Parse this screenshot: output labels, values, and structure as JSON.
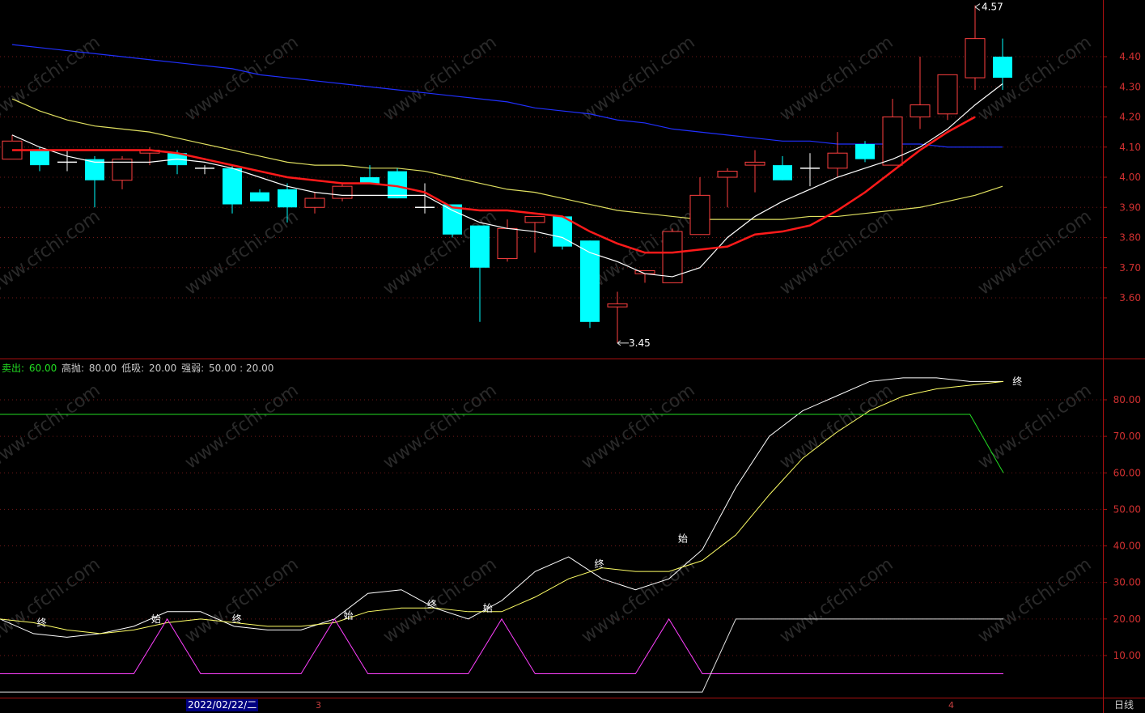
{
  "chart_data": [
    {
      "type": "candlestick",
      "y_ticks": [
        "4.40",
        "4.30",
        "4.20",
        "4.10",
        "4.00",
        "3.90",
        "3.80",
        "3.70",
        "3.60"
      ],
      "ylim": [
        3.42,
        4.58
      ],
      "candles": [
        {
          "o": 4.06,
          "h": 4.14,
          "l": 4.06,
          "c": 4.12
        },
        {
          "o": 4.09,
          "h": 4.1,
          "l": 4.02,
          "c": 4.04
        },
        {
          "o": 4.05,
          "h": 4.09,
          "l": 4.02,
          "c": 4.05
        },
        {
          "o": 4.06,
          "h": 4.07,
          "l": 3.9,
          "c": 3.99
        },
        {
          "o": 3.99,
          "h": 4.07,
          "l": 3.96,
          "c": 4.06
        },
        {
          "o": 4.08,
          "h": 4.1,
          "l": 4.04,
          "c": 4.09
        },
        {
          "o": 4.08,
          "h": 4.09,
          "l": 4.01,
          "c": 4.04
        },
        {
          "o": 4.03,
          "h": 4.04,
          "l": 4.01,
          "c": 4.03
        },
        {
          "o": 4.03,
          "h": 4.04,
          "l": 3.88,
          "c": 3.91
        },
        {
          "o": 3.95,
          "h": 3.96,
          "l": 3.92,
          "c": 3.92
        },
        {
          "o": 3.96,
          "h": 3.98,
          "l": 3.85,
          "c": 3.9
        },
        {
          "o": 3.9,
          "h": 3.95,
          "l": 3.88,
          "c": 3.93
        },
        {
          "o": 3.93,
          "h": 3.98,
          "l": 3.92,
          "c": 3.97
        },
        {
          "o": 4.0,
          "h": 4.04,
          "l": 3.98,
          "c": 3.98
        },
        {
          "o": 4.02,
          "h": 4.03,
          "l": 3.93,
          "c": 3.93
        },
        {
          "o": 3.9,
          "h": 3.98,
          "l": 3.88,
          "c": 3.9
        },
        {
          "o": 3.91,
          "h": 3.91,
          "l": 3.8,
          "c": 3.81
        },
        {
          "o": 3.84,
          "h": 3.84,
          "l": 3.52,
          "c": 3.7
        },
        {
          "o": 3.73,
          "h": 3.86,
          "l": 3.72,
          "c": 3.83
        },
        {
          "o": 3.85,
          "h": 3.87,
          "l": 3.75,
          "c": 3.87
        },
        {
          "o": 3.87,
          "h": 3.87,
          "l": 3.76,
          "c": 3.77
        },
        {
          "o": 3.79,
          "h": 3.79,
          "l": 3.5,
          "c": 3.52
        },
        {
          "o": 3.57,
          "h": 3.62,
          "l": 3.45,
          "c": 3.58
        },
        {
          "o": 3.68,
          "h": 3.69,
          "l": 3.65,
          "c": 3.69
        },
        {
          "o": 3.65,
          "h": 3.83,
          "l": 3.65,
          "c": 3.82
        },
        {
          "o": 3.81,
          "h": 4.0,
          "l": 3.81,
          "c": 3.94
        },
        {
          "o": 4.0,
          "h": 4.03,
          "l": 3.9,
          "c": 4.02
        },
        {
          "o": 4.04,
          "h": 4.09,
          "l": 3.95,
          "c": 4.05
        },
        {
          "o": 4.04,
          "h": 4.07,
          "l": 3.99,
          "c": 3.99
        },
        {
          "o": 4.03,
          "h": 4.08,
          "l": 3.97,
          "c": 4.03
        },
        {
          "o": 4.03,
          "h": 4.15,
          "l": 4.0,
          "c": 4.08
        },
        {
          "o": 4.11,
          "h": 4.12,
          "l": 4.05,
          "c": 4.06
        },
        {
          "o": 4.04,
          "h": 4.26,
          "l": 4.04,
          "c": 4.2
        },
        {
          "o": 4.2,
          "h": 4.4,
          "l": 4.16,
          "c": 4.24
        },
        {
          "o": 4.21,
          "h": 4.34,
          "l": 4.19,
          "c": 4.34
        },
        {
          "o": 4.33,
          "h": 4.57,
          "l": 4.29,
          "c": 4.46
        },
        {
          "o": 4.4,
          "h": 4.46,
          "l": 4.29,
          "c": 4.33
        }
      ],
      "ma_white": [
        4.14,
        4.1,
        4.07,
        4.05,
        4.05,
        4.05,
        4.06,
        4.05,
        4.03,
        4.0,
        3.97,
        3.95,
        3.94,
        3.94,
        3.94,
        3.94,
        3.89,
        3.85,
        3.83,
        3.82,
        3.8,
        3.75,
        3.72,
        3.68,
        3.67,
        3.7,
        3.8,
        3.87,
        3.92,
        3.96,
        4.0,
        4.03,
        4.06,
        4.1,
        4.16,
        4.24,
        4.31
      ],
      "ma_red": [
        4.09,
        4.09,
        4.09,
        4.09,
        4.09,
        4.09,
        4.08,
        4.06,
        4.04,
        4.02,
        4.0,
        3.99,
        3.98,
        3.98,
        3.97,
        3.95,
        3.9,
        3.89,
        3.89,
        3.88,
        3.87,
        3.82,
        3.78,
        3.75,
        3.75,
        3.76,
        3.77,
        3.81,
        3.82,
        3.84,
        3.89,
        3.95,
        4.02,
        4.09,
        4.15,
        4.2
      ],
      "ma_yellow": [
        4.26,
        4.22,
        4.19,
        4.17,
        4.16,
        4.15,
        4.13,
        4.11,
        4.09,
        4.07,
        4.05,
        4.04,
        4.04,
        4.03,
        4.03,
        4.02,
        4.0,
        3.98,
        3.96,
        3.95,
        3.93,
        3.91,
        3.89,
        3.88,
        3.87,
        3.86,
        3.86,
        3.86,
        3.86,
        3.87,
        3.87,
        3.88,
        3.89,
        3.9,
        3.92,
        3.94,
        3.97
      ],
      "ma_blue": [
        4.44,
        4.43,
        4.42,
        4.41,
        4.4,
        4.39,
        4.38,
        4.37,
        4.36,
        4.34,
        4.33,
        4.32,
        4.31,
        4.3,
        4.29,
        4.28,
        4.27,
        4.26,
        4.25,
        4.23,
        4.22,
        4.21,
        4.19,
        4.18,
        4.16,
        4.15,
        4.14,
        4.13,
        4.12,
        4.12,
        4.11,
        4.11,
        4.11,
        4.11,
        4.1,
        4.1,
        4.1
      ],
      "high_label": "4.57",
      "low_label": "3.45",
      "high_index": 35,
      "low_index": 22
    },
    {
      "type": "line",
      "title_items": [
        {
          "label": "卖出: ",
          "value": "60.00",
          "color": "#22dd22"
        },
        {
          "label": "高抛: ",
          "value": "80.00",
          "color": "#d0d0d0"
        },
        {
          "label": "低吸: ",
          "value": "20.00",
          "color": "#d0d0d0"
        },
        {
          "label": "强弱: ",
          "value": "50.00 : 20.00",
          "color": "#d0d0d0"
        }
      ],
      "y_ticks": [
        "80.00",
        "70.00",
        "60.00",
        "50.00",
        "40.00",
        "30.00",
        "20.00",
        "10.00"
      ],
      "ylim": [
        0,
        90
      ],
      "series": [
        {
          "name": "white",
          "color": "#ffffff",
          "values": [
            20,
            16,
            15,
            16,
            18,
            22,
            22,
            18,
            17,
            17,
            20,
            27,
            28,
            23,
            20,
            25,
            33,
            37,
            31,
            28,
            31,
            39,
            56,
            70,
            77,
            81,
            85,
            86,
            86,
            85,
            85
          ]
        },
        {
          "name": "yellow",
          "color": "#ffff66",
          "values": [
            20,
            19,
            17,
            16,
            17,
            19,
            20,
            19,
            18,
            18,
            19,
            22,
            23,
            23,
            22,
            22,
            26,
            31,
            34,
            33,
            33,
            36,
            43,
            54,
            64,
            71,
            77,
            81,
            83,
            84,
            85
          ]
        },
        {
          "name": "green",
          "color": "#22dd22",
          "values": [
            76,
            76,
            76,
            76,
            76,
            76,
            76,
            76,
            76,
            76,
            76,
            76,
            76,
            76,
            76,
            76,
            76,
            76,
            76,
            76,
            76,
            76,
            76,
            76,
            76,
            76,
            76,
            76,
            76,
            76,
            60
          ]
        },
        {
          "name": "magenta",
          "color": "#ff40ff",
          "values": [
            5,
            5,
            5,
            5,
            5,
            20,
            5,
            5,
            5,
            5,
            20,
            5,
            5,
            5,
            5,
            20,
            5,
            5,
            5,
            5,
            20,
            5,
            5,
            5,
            5,
            5,
            5,
            5,
            5,
            5,
            5
          ]
        },
        {
          "name": "grayline",
          "color": "#e0e0e0",
          "values": [
            0,
            0,
            0,
            0,
            0,
            0,
            0,
            0,
            0,
            0,
            0,
            0,
            0,
            0,
            0,
            0,
            0,
            0,
            0,
            0,
            0,
            0,
            20,
            20,
            20,
            20,
            20,
            20,
            20,
            20,
            20
          ]
        }
      ],
      "markers": [
        {
          "text": "终",
          "index": 1.5,
          "value": 19
        },
        {
          "text": "始",
          "index": 5.6,
          "value": 20
        },
        {
          "text": "终",
          "index": 8.5,
          "value": 20
        },
        {
          "text": "始",
          "index": 12.5,
          "value": 21
        },
        {
          "text": "终",
          "index": 15.5,
          "value": 24
        },
        {
          "text": "始",
          "index": 17.5,
          "value": 23
        },
        {
          "text": "终",
          "index": 21.5,
          "value": 35
        },
        {
          "text": "始",
          "index": 24.5,
          "value": 42
        },
        {
          "text": "终",
          "index": 36.5,
          "value": 85
        }
      ]
    }
  ],
  "watermark": "www.cfchi.com",
  "x_axis": {
    "date": "2022/02/22/二",
    "month_labels": [
      {
        "text": "3",
        "index": 11.3
      },
      {
        "text": "4",
        "index": 34.3
      }
    ],
    "period": "日线"
  }
}
